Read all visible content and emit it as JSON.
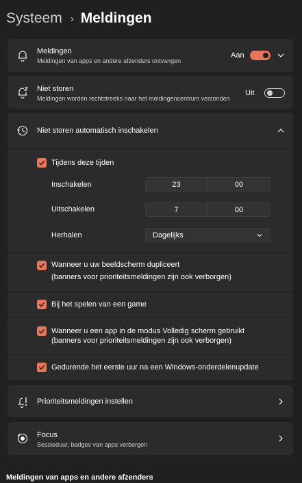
{
  "breadcrumb": {
    "parent": "Systeem",
    "separator": "›",
    "current": "Meldingen"
  },
  "notifications": {
    "title": "Meldingen",
    "description": "Meldingen van apps en andere afzenders ontvangen",
    "state": "Aan",
    "icon": "bell-icon"
  },
  "dnd": {
    "title": "Niet storen",
    "description": "Meldingen worden rechtstreeks naar het meldingencentrum verzonden",
    "state": "Uit",
    "icon": "bell-zz-icon"
  },
  "auto_dnd": {
    "title": "Niet storen automatisch inschakelen",
    "icon": "clock-icon",
    "during_times": {
      "label": "Tijdens deze tijden",
      "checked": true
    },
    "turn_on": {
      "label": "Inschakelen",
      "hour": "23",
      "minute": "00"
    },
    "turn_off": {
      "label": "Uitschakelen",
      "hour": "7",
      "minute": "00"
    },
    "repeat": {
      "label": "Herhalen",
      "value": "Dagelijks"
    },
    "options": [
      {
        "line1": "Wanneer u uw beeldscherm dupliceert",
        "line2": "(banners voor prioriteitsmeldingen zijn ook verborgen)",
        "checked": true
      },
      {
        "line1": "Bij het spelen van een game",
        "line2": "",
        "checked": true
      },
      {
        "line1": "Wanneer u een app in de modus Volledig scherm gebruikt",
        "line2": "(banners voor prioriteitsmeldingen zijn ook verborgen)",
        "checked": true
      },
      {
        "line1": "Gedurende het eerste uur na een Windows-onderdelenupdate",
        "line2": "",
        "checked": true
      }
    ]
  },
  "priority": {
    "title": "Prioriteitsmeldingen instellen",
    "icon": "priority-bell-icon"
  },
  "focus": {
    "title": "Focus",
    "description": "Sessieduur, badges van apps verbergen",
    "icon": "focus-icon"
  },
  "section_heading": "Meldingen van apps en andere afzenders",
  "colors": {
    "accent": "#e8765a",
    "background": "#202020",
    "card": "#2b2b2b"
  }
}
